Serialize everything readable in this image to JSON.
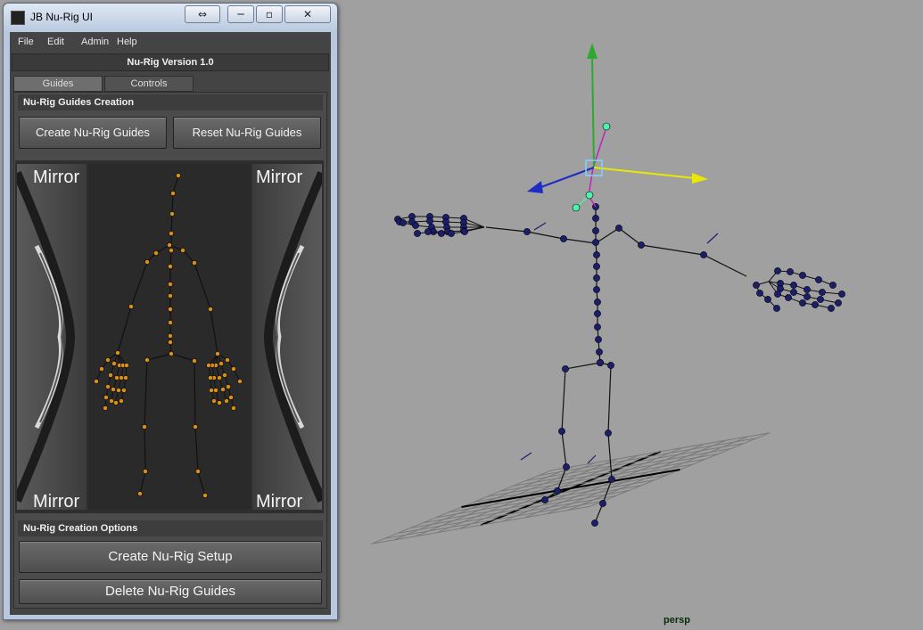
{
  "window": {
    "title": "JB Nu-Rig UI",
    "controls": {
      "resize": "⇔",
      "minimize": "─",
      "maximize": "▫",
      "close": "✕"
    }
  },
  "menu": [
    "File",
    "Edit",
    "Admin",
    "Help"
  ],
  "version_label": "Nu-Rig  Version 1.0",
  "tabs": [
    {
      "label": "Guides",
      "active": true
    },
    {
      "label": "Controls",
      "active": false
    }
  ],
  "guides_section": {
    "title": "Nu-Rig Guides Creation",
    "create_button": "Create Nu-Rig Guides",
    "reset_button": "Reset Nu-Rig Guides"
  },
  "mirror_labels": {
    "top_left": "Mirror",
    "top_right": "Mirror",
    "bottom_left": "Mirror",
    "bottom_right": "Mirror"
  },
  "options_section": {
    "title": "Nu-Rig Creation Options",
    "setup_button": "Create Nu-Rig Setup",
    "delete_button": "Delete Nu-Rig Guides"
  },
  "viewport": {
    "camera_label": "persp",
    "background": "#a0a0a0",
    "joint_color": "#1b1f6b",
    "guide_joint_color": "#d8901a",
    "axis_colors": {
      "y": "#2ea82e",
      "x": "#e8e800",
      "z": "#1c2cc4",
      "selected": "#c020c0",
      "handle": "#4cf3a8"
    }
  }
}
